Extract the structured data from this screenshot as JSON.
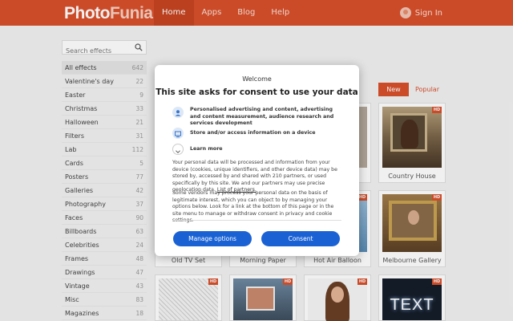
{
  "header": {
    "logo_photo": "Photo",
    "logo_funia": "Funia",
    "nav": [
      "Home",
      "Apps",
      "Blog",
      "Help"
    ],
    "signin": "Sign In"
  },
  "sidebar": {
    "search_placeholder": "Search effects",
    "categories": [
      {
        "name": "All effects",
        "count": "642"
      },
      {
        "name": "Valentine's day",
        "count": "22"
      },
      {
        "name": "Easter",
        "count": "9"
      },
      {
        "name": "Christmas",
        "count": "33"
      },
      {
        "name": "Halloween",
        "count": "21"
      },
      {
        "name": "Filters",
        "count": "31"
      },
      {
        "name": "Lab",
        "count": "112"
      },
      {
        "name": "Cards",
        "count": "5"
      },
      {
        "name": "Posters",
        "count": "77"
      },
      {
        "name": "Galleries",
        "count": "42"
      },
      {
        "name": "Photography",
        "count": "37"
      },
      {
        "name": "Faces",
        "count": "90"
      },
      {
        "name": "Billboards",
        "count": "63"
      },
      {
        "name": "Celebrities",
        "count": "24"
      },
      {
        "name": "Frames",
        "count": "48"
      },
      {
        "name": "Drawings",
        "count": "47"
      },
      {
        "name": "Vintage",
        "count": "43"
      },
      {
        "name": "Misc",
        "count": "83"
      },
      {
        "name": "Magazines",
        "count": "18"
      }
    ]
  },
  "tabs": {
    "new": "New",
    "popular": "Popular"
  },
  "tiles": {
    "country_house": "Country House",
    "old_tv_set": "Old TV Set",
    "morning_paper": "Morning Paper",
    "hot_air_balloon": "Hot Air Balloon",
    "melbourne_gallery": "Melbourne Gallery",
    "hd": "HD",
    "text_tile": "TEXT"
  },
  "modal": {
    "welcome": "Welcome",
    "title": "This site asks for consent to use your data",
    "item1": "Personalised advertising and content, advertising and content measurement, audience research and services development",
    "item2": "Store and/or access information on a device",
    "item3": "Learn more",
    "para1": "Your personal data will be processed and information from your device (cookies, unique identifiers, and other device data) may be stored by, accessed by and shared with 210 partners, or used specifically by this site. We and our partners may use precise geolocation data.",
    "para1_link": "List of partners.",
    "para2": "Some vendors may process your personal data on the basis of legitimate interest, which you can object to by managing your options below. Look for a link at the bottom of this page or in the site menu to manage or withdraw consent in privacy and cookie settings.",
    "manage": "Manage options",
    "consent": "Consent"
  }
}
